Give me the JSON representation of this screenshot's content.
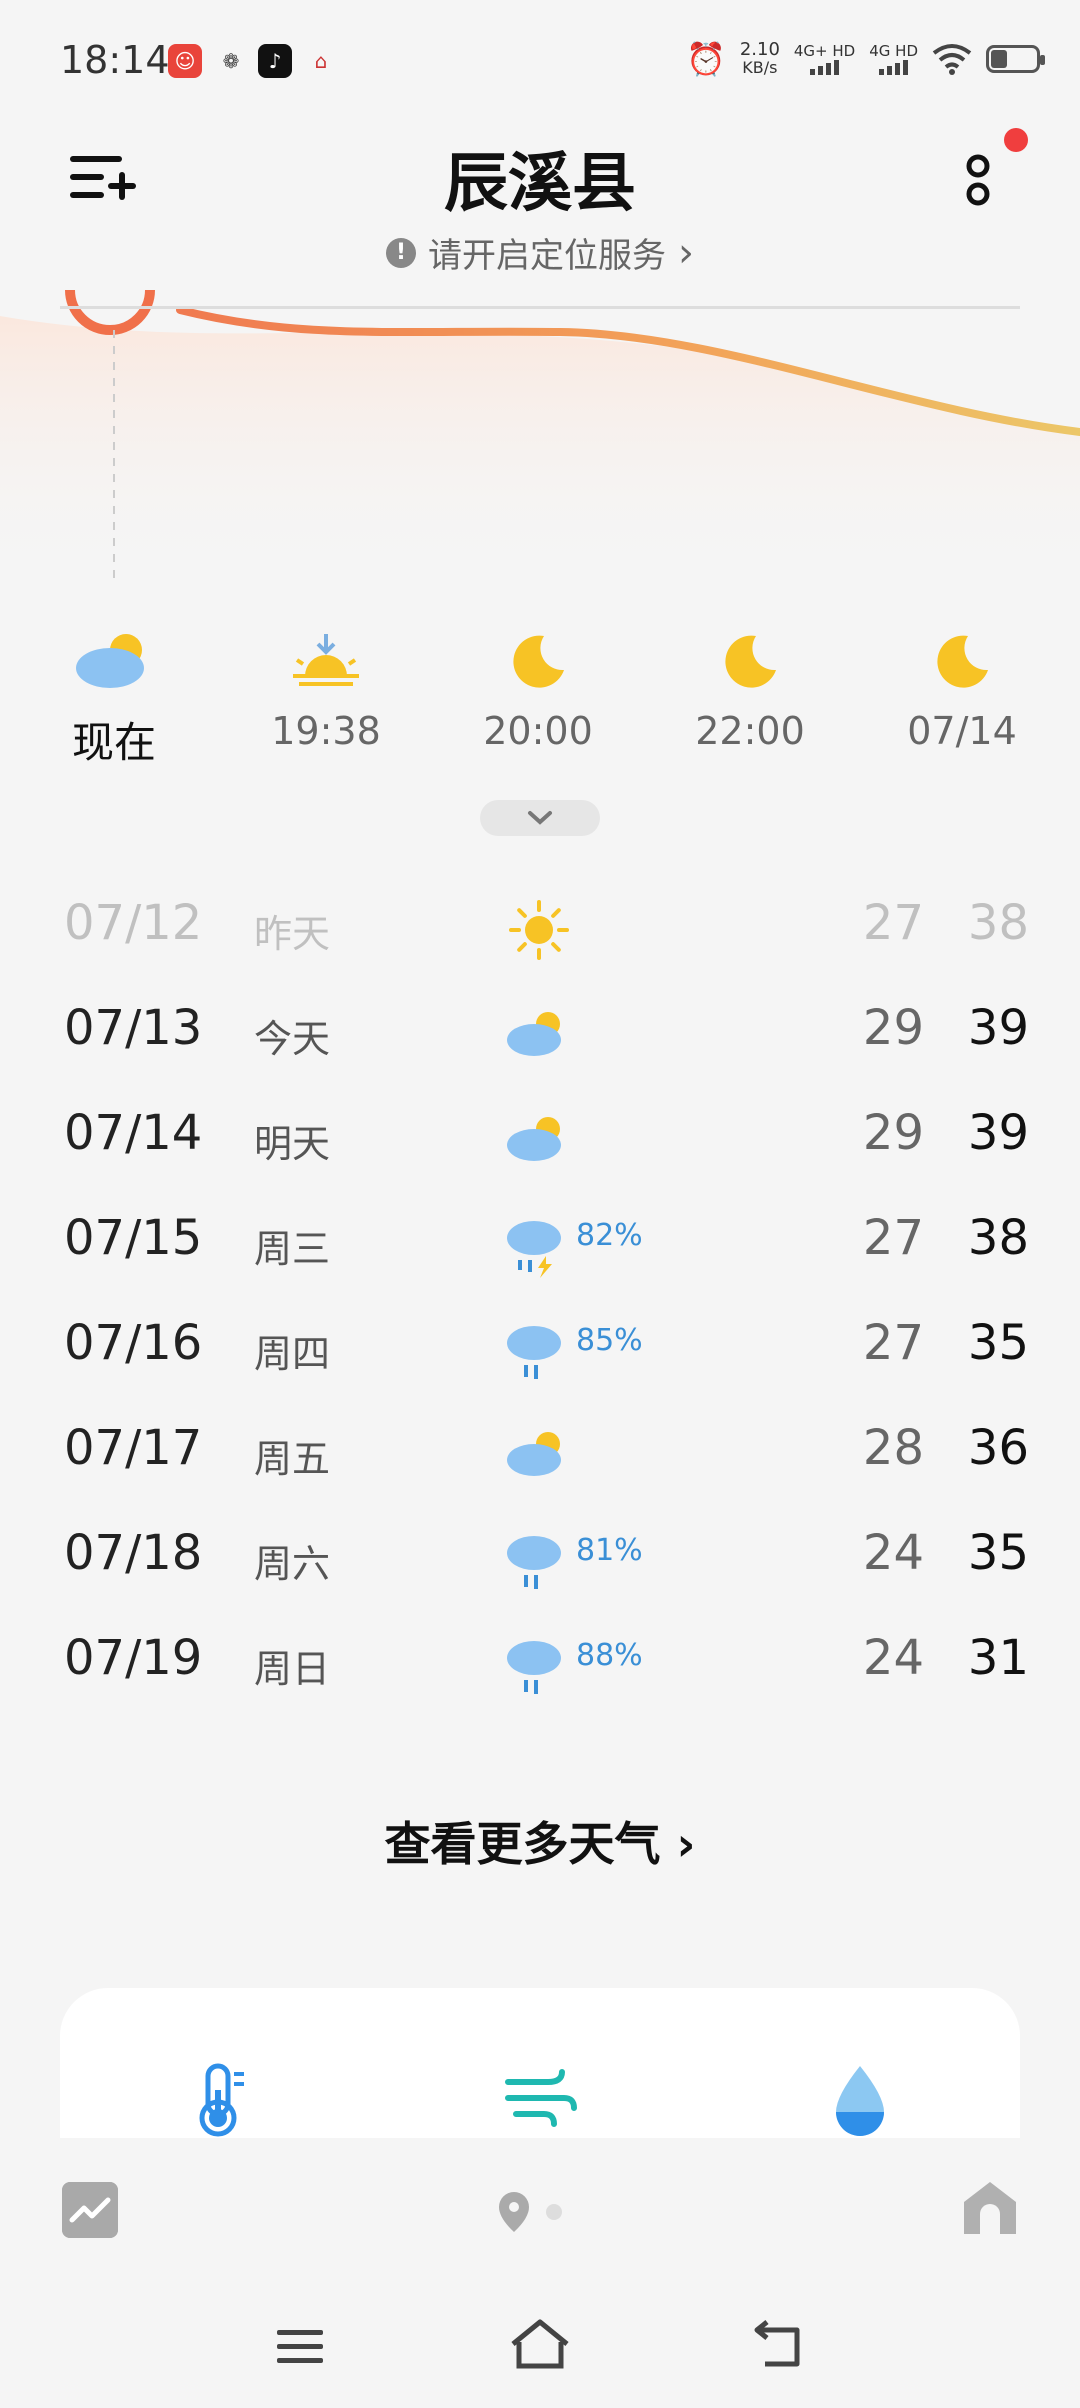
{
  "status": {
    "time": "18:14",
    "net_speed_value": "2.10",
    "net_speed_unit": "KB/s",
    "signal1_label": "4G+ HD",
    "signal2_label": "4G HD",
    "battery_level": 0.4
  },
  "header": {
    "city": "辰溪县",
    "location_prompt": "请开启定位服务",
    "location_chevron": "›"
  },
  "hourly": [
    {
      "label": "现在",
      "icon": "cloudy-sun-icon"
    },
    {
      "label": "19:38",
      "icon": "sunset-icon"
    },
    {
      "label": "20:00",
      "icon": "moon-icon"
    },
    {
      "label": "22:00",
      "icon": "moon-icon"
    },
    {
      "label": "07/14",
      "icon": "moon-icon"
    }
  ],
  "daily": [
    {
      "date": "07/12",
      "name": "昨天",
      "icon": "sun-icon",
      "precip": "",
      "low": "27",
      "high": "38",
      "past": true
    },
    {
      "date": "07/13",
      "name": "今天",
      "icon": "cloudy-sun-icon",
      "precip": "",
      "low": "29",
      "high": "39"
    },
    {
      "date": "07/14",
      "name": "明天",
      "icon": "cloudy-sun-icon",
      "precip": "",
      "low": "29",
      "high": "39"
    },
    {
      "date": "07/15",
      "name": "周三",
      "icon": "thunder-rain-icon",
      "precip": "82%",
      "low": "27",
      "high": "38"
    },
    {
      "date": "07/16",
      "name": "周四",
      "icon": "rain-icon",
      "precip": "85%",
      "low": "27",
      "high": "35"
    },
    {
      "date": "07/17",
      "name": "周五",
      "icon": "cloudy-sun-icon",
      "precip": "",
      "low": "28",
      "high": "36"
    },
    {
      "date": "07/18",
      "name": "周六",
      "icon": "rain-icon",
      "precip": "81%",
      "low": "24",
      "high": "35"
    },
    {
      "date": "07/19",
      "name": "周日",
      "icon": "rain-icon",
      "precip": "88%",
      "low": "24",
      "high": "31"
    }
  ],
  "more_weather": "查看更多天气 ›",
  "colors": {
    "curve": "#f0a050",
    "precip": "#3a8fd6",
    "card_blue": "#2f8fe8",
    "card_teal": "#1fb8b0"
  }
}
